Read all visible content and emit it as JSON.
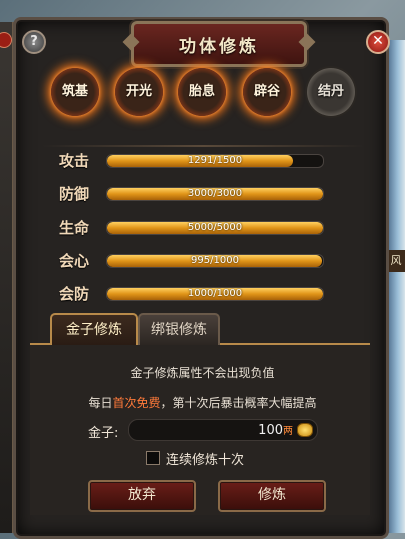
{
  "window": {
    "title": "功体修炼",
    "help": "?",
    "close": "✕"
  },
  "side": {
    "tag": "风"
  },
  "stages": [
    {
      "label": "筑基",
      "state": "active"
    },
    {
      "label": "开光",
      "state": "active"
    },
    {
      "label": "胎息",
      "state": "active"
    },
    {
      "label": "辟谷",
      "state": "active"
    },
    {
      "label": "结丹",
      "state": "locked"
    }
  ],
  "stats": [
    {
      "label": "攻击",
      "text": "1291/1500",
      "ratio": 0.861
    },
    {
      "label": "防御",
      "text": "3000/3000",
      "ratio": 1.0
    },
    {
      "label": "生命",
      "text": "5000/5000",
      "ratio": 1.0
    },
    {
      "label": "会心",
      "text": "995/1000",
      "ratio": 0.995
    },
    {
      "label": "会防",
      "text": "1000/1000",
      "ratio": 1.0
    }
  ],
  "tabs": {
    "gold": "金子修炼",
    "bound": "绑银修炼"
  },
  "notes": {
    "line1": "金子修炼属性不会出现负值",
    "line2_pre": "每日",
    "line2_hl": "首次免费",
    "line2_post": "，第十次后暴击概率大幅提高"
  },
  "gold": {
    "label": "金子:",
    "value": "100",
    "unit": "两"
  },
  "checkbox": {
    "label": "连续修炼十次",
    "checked": false
  },
  "buttons": {
    "abandon": "放弃",
    "train": "修炼"
  },
  "colors": {
    "accent": "#e09418",
    "highlight": "#ff7a3a",
    "panel": "#262321"
  }
}
